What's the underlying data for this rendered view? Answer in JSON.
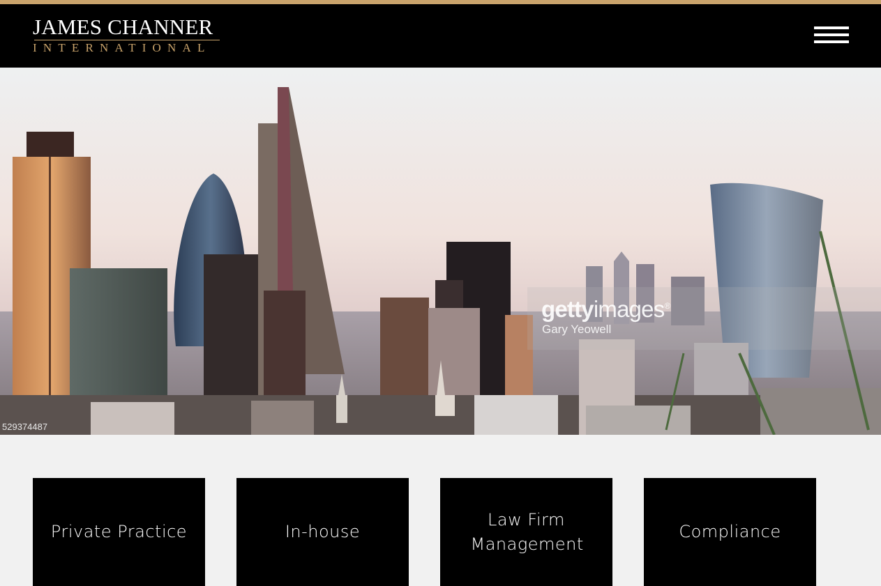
{
  "brand": {
    "name": "JAMES CHANNER",
    "sub": "INTERNATIONAL",
    "accent_color": "#c9a36b",
    "header_color": "#000000"
  },
  "nav": {
    "menu_icon": "hamburger-menu-icon"
  },
  "hero": {
    "image_id": "529374487",
    "watermark_brand_bold": "getty",
    "watermark_brand_light": "images",
    "watermark_mark": "®",
    "photo_credit": "Gary Yeowell"
  },
  "practice_areas": [
    {
      "label": "Private Practice"
    },
    {
      "label": "In-house"
    },
    {
      "label": "Law Firm Management"
    },
    {
      "label": "Compliance"
    }
  ]
}
